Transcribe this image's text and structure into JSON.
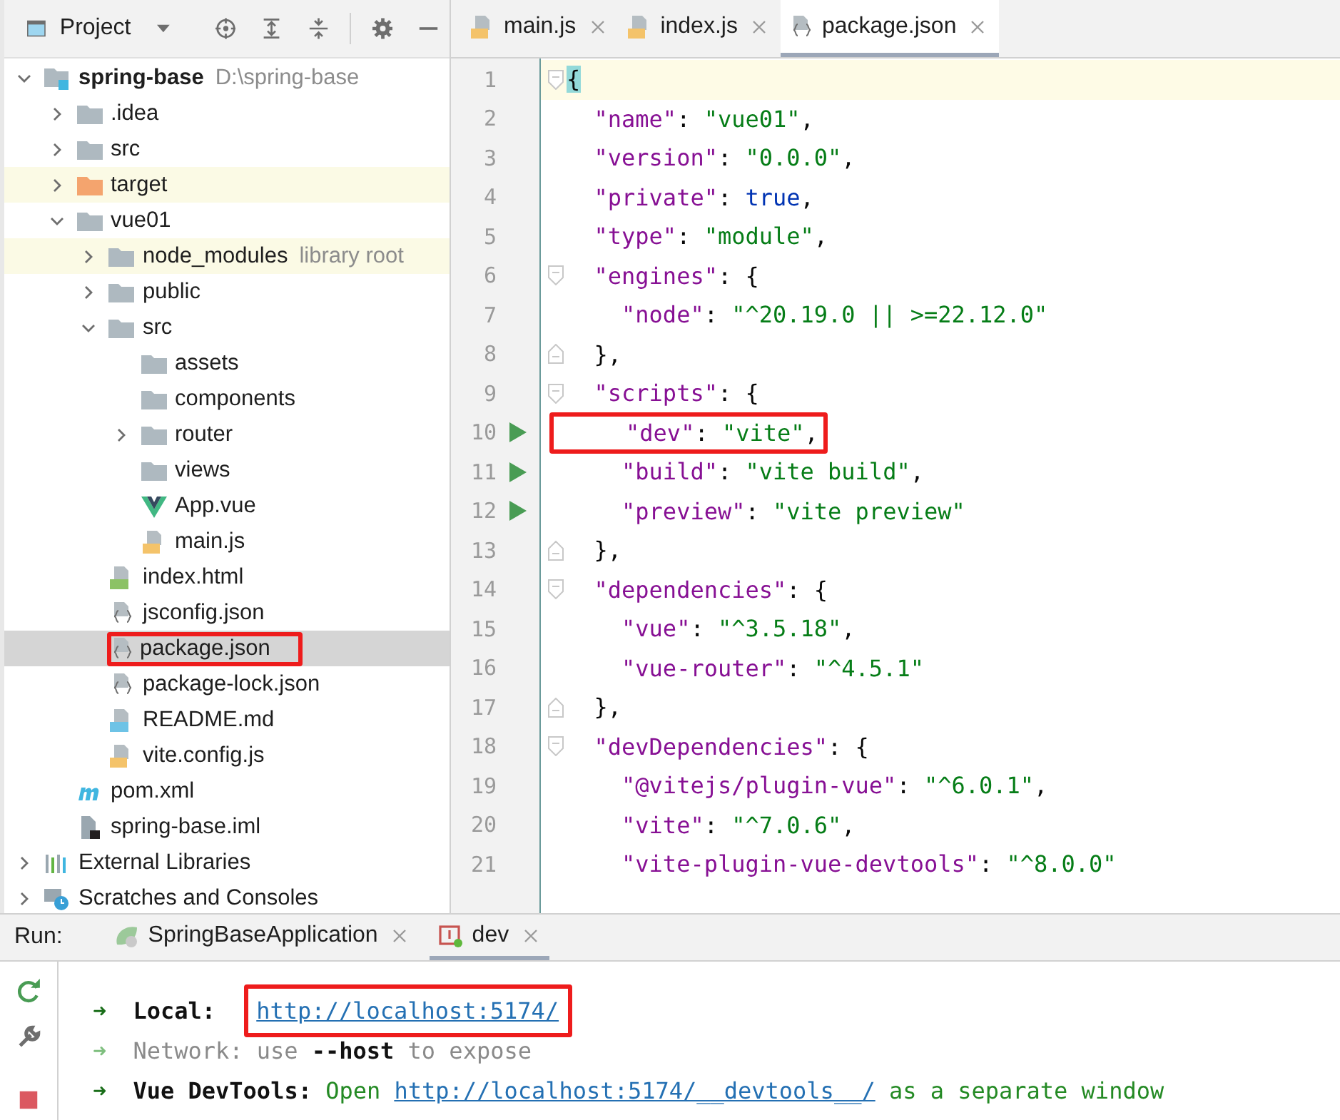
{
  "project_panel": {
    "title": "Project",
    "tree": [
      {
        "label": "spring-base",
        "hint": "D:\\spring-base",
        "kind": "module",
        "bold": true,
        "expanded": true,
        "selected": false,
        "tinted": false,
        "highlighted": false,
        "children": [
          {
            "label": ".idea",
            "kind": "folder",
            "bold": false,
            "expanded": false,
            "selected": false,
            "tinted": false,
            "highlighted": false
          },
          {
            "label": "src",
            "kind": "folder",
            "bold": false,
            "expanded": false,
            "selected": false,
            "tinted": false,
            "highlighted": false
          },
          {
            "label": "target",
            "kind": "excluded-folder",
            "bold": false,
            "expanded": false,
            "selected": false,
            "tinted": true,
            "highlighted": false
          },
          {
            "label": "vue01",
            "kind": "folder",
            "bold": false,
            "expanded": true,
            "selected": false,
            "tinted": false,
            "highlighted": false,
            "children": [
              {
                "label": "node_modules",
                "hint": "library root",
                "kind": "folder",
                "bold": false,
                "expanded": false,
                "selected": false,
                "tinted": true,
                "highlighted": false
              },
              {
                "label": "public",
                "kind": "folder",
                "bold": false,
                "expanded": false,
                "selected": false,
                "tinted": false,
                "highlighted": false
              },
              {
                "label": "src",
                "kind": "folder",
                "bold": false,
                "expanded": true,
                "selected": false,
                "tinted": false,
                "highlighted": false,
                "children": [
                  {
                    "label": "assets",
                    "kind": "folder",
                    "bold": false,
                    "selected": false,
                    "tinted": false,
                    "highlighted": false
                  },
                  {
                    "label": "components",
                    "kind": "folder",
                    "bold": false,
                    "selected": false,
                    "tinted": false,
                    "highlighted": false
                  },
                  {
                    "label": "router",
                    "kind": "folder",
                    "bold": false,
                    "expanded": false,
                    "selected": false,
                    "tinted": false,
                    "highlighted": false
                  },
                  {
                    "label": "views",
                    "kind": "folder",
                    "bold": false,
                    "selected": false,
                    "tinted": false,
                    "highlighted": false
                  },
                  {
                    "label": "App.vue",
                    "kind": "vue",
                    "bold": false,
                    "selected": false,
                    "tinted": false,
                    "highlighted": false
                  },
                  {
                    "label": "main.js",
                    "kind": "js",
                    "bold": false,
                    "selected": false,
                    "tinted": false,
                    "highlighted": false
                  }
                ]
              },
              {
                "label": "index.html",
                "kind": "html",
                "bold": false,
                "selected": false,
                "tinted": false,
                "highlighted": false
              },
              {
                "label": "jsconfig.json",
                "kind": "json",
                "bold": false,
                "selected": false,
                "tinted": false,
                "highlighted": false
              },
              {
                "label": "package.json",
                "kind": "json",
                "bold": false,
                "selected": true,
                "tinted": false,
                "highlighted": true
              },
              {
                "label": "package-lock.json",
                "kind": "json",
                "bold": false,
                "selected": false,
                "tinted": false,
                "highlighted": false
              },
              {
                "label": "README.md",
                "kind": "md",
                "bold": false,
                "selected": false,
                "tinted": false,
                "highlighted": false
              },
              {
                "label": "vite.config.js",
                "kind": "js",
                "bold": false,
                "selected": false,
                "tinted": false,
                "highlighted": false
              }
            ]
          },
          {
            "label": "pom.xml",
            "kind": "maven",
            "bold": false,
            "selected": false,
            "tinted": false,
            "highlighted": false
          },
          {
            "label": "spring-base.iml",
            "kind": "iml",
            "bold": false,
            "selected": false,
            "tinted": false,
            "highlighted": false
          }
        ]
      },
      {
        "label": "External Libraries",
        "kind": "libraries",
        "bold": false,
        "expanded": false,
        "selected": false,
        "tinted": false,
        "highlighted": false
      },
      {
        "label": "Scratches and Consoles",
        "kind": "scratches",
        "bold": false,
        "expanded": false,
        "selected": false,
        "tinted": false,
        "highlighted": false
      }
    ]
  },
  "editor": {
    "tabs": [
      {
        "label": "main.js",
        "kind": "js",
        "selected": false
      },
      {
        "label": "index.js",
        "kind": "js",
        "selected": false
      },
      {
        "label": "package.json",
        "kind": "json",
        "selected": true
      }
    ],
    "lines": [
      {
        "number": "1",
        "current": true,
        "runnable": false,
        "kind": "fold-start",
        "highlighted": false,
        "tokens": [
          {
            "kind": "brace-match",
            "s": "{"
          }
        ]
      },
      {
        "number": "2",
        "current": false,
        "runnable": false,
        "kind": "plain",
        "highlighted": false,
        "tokens": [
          {
            "kind": "key",
            "s": "  \"name\""
          },
          {
            "kind": "punct",
            "s": ": "
          },
          {
            "kind": "string",
            "s": "\"vue01\""
          },
          {
            "kind": "punct",
            "s": ","
          }
        ]
      },
      {
        "number": "3",
        "current": false,
        "runnable": false,
        "kind": "plain",
        "highlighted": false,
        "tokens": [
          {
            "kind": "key",
            "s": "  \"version\""
          },
          {
            "kind": "punct",
            "s": ": "
          },
          {
            "kind": "string",
            "s": "\"0.0.0\""
          },
          {
            "kind": "punct",
            "s": ","
          }
        ]
      },
      {
        "number": "4",
        "current": false,
        "runnable": false,
        "kind": "plain",
        "highlighted": false,
        "tokens": [
          {
            "kind": "key",
            "s": "  \"private\""
          },
          {
            "kind": "punct",
            "s": ": "
          },
          {
            "kind": "keyword",
            "s": "true"
          },
          {
            "kind": "punct",
            "s": ","
          }
        ]
      },
      {
        "number": "5",
        "current": false,
        "runnable": false,
        "kind": "plain",
        "highlighted": false,
        "tokens": [
          {
            "kind": "key",
            "s": "  \"type\""
          },
          {
            "kind": "punct",
            "s": ": "
          },
          {
            "kind": "string",
            "s": "\"module\""
          },
          {
            "kind": "punct",
            "s": ","
          }
        ]
      },
      {
        "number": "6",
        "current": false,
        "runnable": false,
        "kind": "fold-start",
        "highlighted": false,
        "tokens": [
          {
            "kind": "key",
            "s": "  \"engines\""
          },
          {
            "kind": "punct",
            "s": ": {"
          }
        ]
      },
      {
        "number": "7",
        "current": false,
        "runnable": false,
        "kind": "plain",
        "highlighted": false,
        "tokens": [
          {
            "kind": "key",
            "s": "    \"node\""
          },
          {
            "kind": "punct",
            "s": ": "
          },
          {
            "kind": "string",
            "s": "\"^20.19.0 || >=22.12.0\""
          }
        ]
      },
      {
        "number": "8",
        "current": false,
        "runnable": false,
        "kind": "fold-end",
        "highlighted": false,
        "tokens": [
          {
            "kind": "punct",
            "s": "  },"
          }
        ]
      },
      {
        "number": "9",
        "current": false,
        "runnable": false,
        "kind": "fold-start",
        "highlighted": false,
        "tokens": [
          {
            "kind": "key",
            "s": "  \"scripts\""
          },
          {
            "kind": "punct",
            "s": ": {"
          }
        ]
      },
      {
        "number": "10",
        "current": false,
        "runnable": true,
        "kind": "plain",
        "highlighted": true,
        "tokens": [
          {
            "kind": "key",
            "s": "    \"dev\""
          },
          {
            "kind": "punct",
            "s": ": "
          },
          {
            "kind": "string",
            "s": "\"vite\""
          },
          {
            "kind": "punct",
            "s": ","
          }
        ]
      },
      {
        "number": "11",
        "current": false,
        "runnable": true,
        "kind": "plain",
        "highlighted": false,
        "tokens": [
          {
            "kind": "key",
            "s": "    \"build\""
          },
          {
            "kind": "punct",
            "s": ": "
          },
          {
            "kind": "string",
            "s": "\"vite build\""
          },
          {
            "kind": "punct",
            "s": ","
          }
        ]
      },
      {
        "number": "12",
        "current": false,
        "runnable": true,
        "kind": "plain",
        "highlighted": false,
        "tokens": [
          {
            "kind": "key",
            "s": "    \"preview\""
          },
          {
            "kind": "punct",
            "s": ": "
          },
          {
            "kind": "string",
            "s": "\"vite preview\""
          }
        ]
      },
      {
        "number": "13",
        "current": false,
        "runnable": false,
        "kind": "fold-end",
        "highlighted": false,
        "tokens": [
          {
            "kind": "punct",
            "s": "  },"
          }
        ]
      },
      {
        "number": "14",
        "current": false,
        "runnable": false,
        "kind": "fold-start",
        "highlighted": false,
        "tokens": [
          {
            "kind": "key",
            "s": "  \"dependencies\""
          },
          {
            "kind": "punct",
            "s": ": {"
          }
        ]
      },
      {
        "number": "15",
        "current": false,
        "runnable": false,
        "kind": "plain",
        "highlighted": false,
        "tokens": [
          {
            "kind": "key",
            "s": "    \"vue\""
          },
          {
            "kind": "punct",
            "s": ": "
          },
          {
            "kind": "string",
            "s": "\"^3.5.18\""
          },
          {
            "kind": "punct",
            "s": ","
          }
        ]
      },
      {
        "number": "16",
        "current": false,
        "runnable": false,
        "kind": "plain",
        "highlighted": false,
        "tokens": [
          {
            "kind": "key",
            "s": "    \"vue-router\""
          },
          {
            "kind": "punct",
            "s": ": "
          },
          {
            "kind": "string",
            "s": "\"^4.5.1\""
          }
        ]
      },
      {
        "number": "17",
        "current": false,
        "runnable": false,
        "kind": "fold-end",
        "highlighted": false,
        "tokens": [
          {
            "kind": "punct",
            "s": "  },"
          }
        ]
      },
      {
        "number": "18",
        "current": false,
        "runnable": false,
        "kind": "fold-start",
        "highlighted": false,
        "tokens": [
          {
            "kind": "key",
            "s": "  \"devDependencies\""
          },
          {
            "kind": "punct",
            "s": ": {"
          }
        ]
      },
      {
        "number": "19",
        "current": false,
        "runnable": false,
        "kind": "plain",
        "highlighted": false,
        "tokens": [
          {
            "kind": "key",
            "s": "    \"@vitejs/plugin-vue\""
          },
          {
            "kind": "punct",
            "s": ": "
          },
          {
            "kind": "string",
            "s": "\"^6.0.1\""
          },
          {
            "kind": "punct",
            "s": ","
          }
        ]
      },
      {
        "number": "20",
        "current": false,
        "runnable": false,
        "kind": "plain",
        "highlighted": false,
        "tokens": [
          {
            "kind": "key",
            "s": "    \"vite\""
          },
          {
            "kind": "punct",
            "s": ": "
          },
          {
            "kind": "string",
            "s": "\"^7.0.6\""
          },
          {
            "kind": "punct",
            "s": ","
          }
        ]
      },
      {
        "number": "21",
        "current": false,
        "runnable": false,
        "kind": "plain",
        "highlighted": false,
        "tokens": [
          {
            "kind": "key",
            "s": "    \"vite-plugin-vue-devtools\""
          },
          {
            "kind": "punct",
            "s": ": "
          },
          {
            "kind": "string",
            "s": "\"^8.0.0\""
          }
        ]
      }
    ]
  },
  "run_panel": {
    "label": "Run:",
    "tabs": [
      {
        "label": "SpringBaseApplication",
        "kind": "spring",
        "selected": false
      },
      {
        "label": "dev",
        "kind": "npm",
        "selected": true
      }
    ],
    "console": [
      {
        "tokens": [
          {
            "kind": "arrow",
            "s": "➜"
          },
          {
            "kind": "label",
            "s": "Local:"
          },
          {
            "kind": "link",
            "s": "http://localhost:5174/",
            "highlighted": true
          }
        ]
      },
      {
        "tokens": [
          {
            "kind": "arrow-dim",
            "s": "➜"
          },
          {
            "kind": "label-dim",
            "s": "Network:"
          },
          {
            "kind": "dim",
            "s": "use"
          },
          {
            "kind": "bold",
            "s": "--host"
          },
          {
            "kind": "dim",
            "s": "to expose"
          }
        ]
      },
      {
        "tokens": [
          {
            "kind": "arrow",
            "s": "➜"
          },
          {
            "kind": "label",
            "s": "Vue DevTools:"
          },
          {
            "kind": "green",
            "s": "Open"
          },
          {
            "kind": "link",
            "s": "http://localhost:5174/__devtools__/",
            "highlighted": false
          },
          {
            "kind": "green",
            "s": "as a separate window"
          }
        ]
      }
    ]
  }
}
